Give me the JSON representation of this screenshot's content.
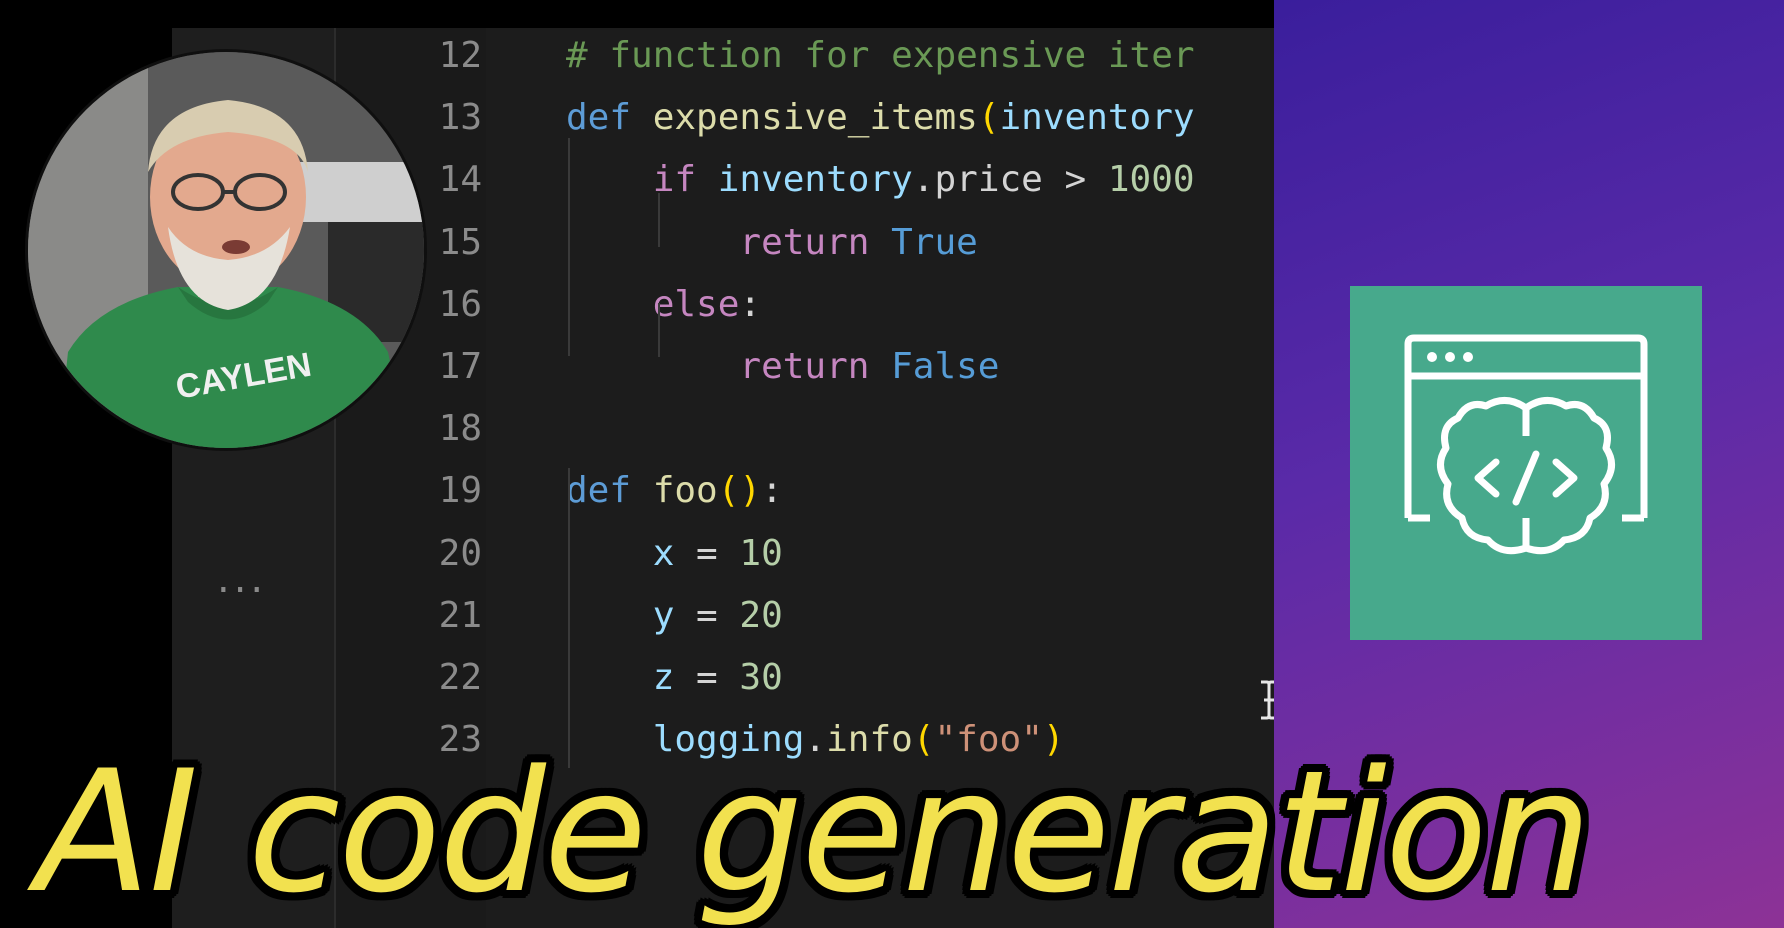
{
  "activity_bar": {
    "more_label": "..."
  },
  "editor": {
    "line_numbers": [
      "12",
      "13",
      "14",
      "15",
      "16",
      "17",
      "18",
      "19",
      "20",
      "21",
      "22",
      "23"
    ],
    "lines": [
      [
        {
          "t": "# function for expensive iter",
          "c": "cmt"
        }
      ],
      [
        {
          "t": "def ",
          "c": "kw"
        },
        {
          "t": "expensive_items",
          "c": "fn"
        },
        {
          "t": "(",
          "c": "paren"
        },
        {
          "t": "inventory",
          "c": "var"
        }
      ],
      [
        {
          "t": "    if ",
          "c": "kw2"
        },
        {
          "t": "inventory",
          "c": "var"
        },
        {
          "t": ".price > ",
          "c": "plain"
        },
        {
          "t": "1000",
          "c": "num"
        }
      ],
      [
        {
          "t": "        return ",
          "c": "kw2"
        },
        {
          "t": "True",
          "c": "bool"
        }
      ],
      [
        {
          "t": "    else",
          "c": "kw2"
        },
        {
          "t": ":",
          "c": "plain"
        }
      ],
      [
        {
          "t": "        return ",
          "c": "kw2"
        },
        {
          "t": "False",
          "c": "bool"
        }
      ],
      [],
      [
        {
          "t": "def ",
          "c": "kw"
        },
        {
          "t": "foo",
          "c": "fn"
        },
        {
          "t": "()",
          "c": "paren"
        },
        {
          "t": ":",
          "c": "plain"
        }
      ],
      [
        {
          "t": "    x",
          "c": "var"
        },
        {
          "t": " = ",
          "c": "plain"
        },
        {
          "t": "10",
          "c": "num"
        }
      ],
      [
        {
          "t": "    y",
          "c": "var"
        },
        {
          "t": " = ",
          "c": "plain"
        },
        {
          "t": "20",
          "c": "num"
        }
      ],
      [
        {
          "t": "    z",
          "c": "var"
        },
        {
          "t": " = ",
          "c": "plain"
        },
        {
          "t": "30",
          "c": "num"
        }
      ],
      [
        {
          "t": "    logging",
          "c": "var"
        },
        {
          "t": ".",
          "c": "plain"
        },
        {
          "t": "info",
          "c": "fn"
        },
        {
          "t": "(",
          "c": "paren"
        },
        {
          "t": "\"foo\"",
          "c": "str"
        },
        {
          "t": ")",
          "c": "paren"
        }
      ]
    ]
  },
  "presenter": {
    "shirt_text": "CAYLEN"
  },
  "promo": {
    "logo_icon": "code-brain-browser-icon",
    "tile_color": "#47a98c",
    "gradient_start": "#3a1e9c",
    "gradient_end": "#8d3296"
  },
  "caption": {
    "text": "AI code generation",
    "color": "#f2e14f"
  }
}
